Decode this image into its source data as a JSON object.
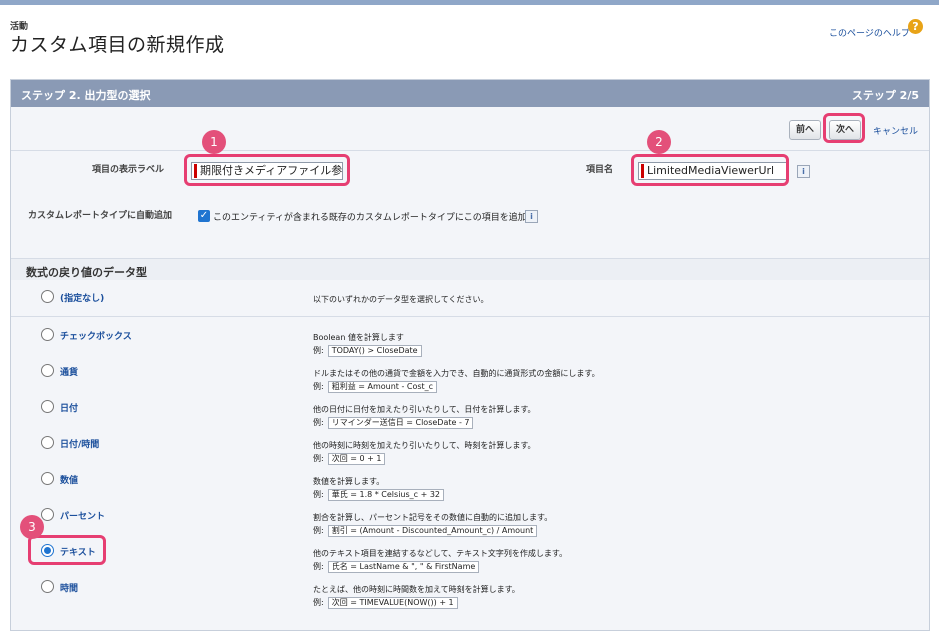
{
  "header": {
    "breadcrumb": "活動",
    "title": "カスタム項目の新規作成",
    "help_link": "このページのヘルプ",
    "help_icon": "?"
  },
  "step_bar": {
    "title": "ステップ 2. 出力型の選択",
    "count": "ステップ 2/5"
  },
  "toolbar": {
    "prev_label": "前へ",
    "next_label": "次へ",
    "cancel_label": "キャンセル"
  },
  "form": {
    "display_label_label": "項目の表示ラベル",
    "display_label_value": "期限付きメディアファイル参照",
    "field_name_label": "項目名",
    "field_name_value": "LimitedMediaViewerUrl",
    "info_icon": "i",
    "auto_add_label": "カスタムレポートタイプに自動追加",
    "auto_add_checkbox_text": "このエンティティが含まれる既存のカスタムレポートタイプにこの項目を追加",
    "checkmark": "✓"
  },
  "section": {
    "title": "数式の戻り値のデータ型"
  },
  "options": [
    {
      "label": "(指定なし)",
      "desc": "以下のいずれかのデータ型を選択してください。",
      "example_prefix": "",
      "example": "",
      "selected": false
    },
    {
      "label": "チェックボックス",
      "desc": "Boolean 値を計算します",
      "example_prefix": "例:",
      "example": "TODAY() > CloseDate",
      "selected": false
    },
    {
      "label": "通貨",
      "desc": "ドルまたはその他の通貨で金額を入力でき、自動的に通貨形式の金額にします。",
      "example_prefix": "例:",
      "example": "粗利益 = Amount - Cost_c",
      "selected": false
    },
    {
      "label": "日付",
      "desc": "他の日付に日付を加えたり引いたりして、日付を計算します。",
      "example_prefix": "例:",
      "example": "リマインダー送信日 = CloseDate - 7",
      "selected": false
    },
    {
      "label": "日付/時間",
      "desc": "他の時刻に時刻を加えたり引いたりして、時刻を計算します。",
      "example_prefix": "例:",
      "example": "次回 = 0 + 1",
      "selected": false
    },
    {
      "label": "数値",
      "desc": "数値を計算します。",
      "example_prefix": "例:",
      "example": "華氏 = 1.8 * Celsius_c + 32",
      "selected": false
    },
    {
      "label": "パーセント",
      "desc": "割合を計算し、パーセント記号をその数値に自動的に追加します。",
      "example_prefix": "例:",
      "example": "割引 = (Amount - Discounted_Amount_c) / Amount",
      "selected": false
    },
    {
      "label": "テキスト",
      "desc": "他のテキスト項目を連結するなどして、テキスト文字列を作成します。",
      "example_prefix": "例:",
      "example": "氏名 = LastName & \", \" & FirstName",
      "selected": true
    },
    {
      "label": "時間",
      "desc": "たとえば、他の時刻に時間数を加えて時刻を計算します。",
      "example_prefix": "例:",
      "example": "次回 = TIMEVALUE(NOW()) + 1",
      "selected": false
    }
  ],
  "annotations": {
    "badge_1": "1",
    "badge_2": "2",
    "badge_3": "3",
    "highlight_color": "#e63e72"
  }
}
